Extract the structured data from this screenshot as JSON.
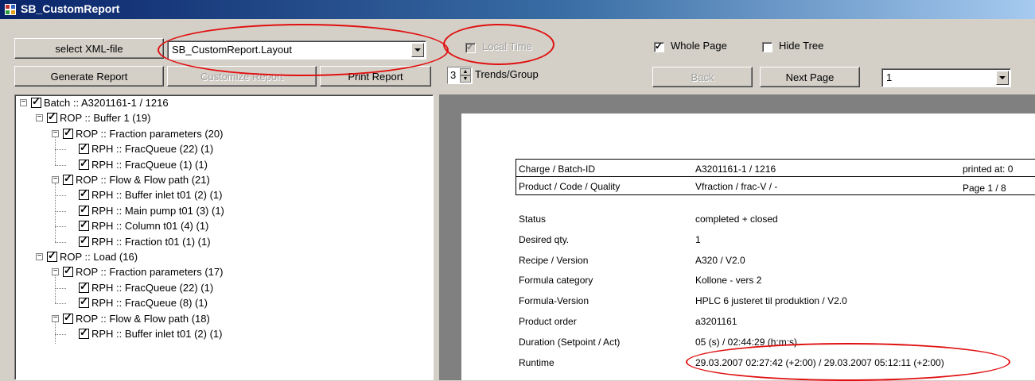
{
  "window": {
    "title": "SB_CustomReport"
  },
  "toolbar": {
    "select_xml_label": "select XML-file",
    "layout_value": "SB_CustomReport.Layout",
    "generate_label": "Generate Report",
    "customize_label": "Customize Report",
    "print_label": "Print Report",
    "local_time_label": "Local Time",
    "local_time_checked": true,
    "trends_value": "3",
    "trends_label": "Trends/Group",
    "whole_page_label": "Whole Page",
    "whole_page_checked": true,
    "hide_tree_label": "Hide Tree",
    "hide_tree_checked": false,
    "back_label": "Back",
    "next_page_label": "Next Page",
    "page_value": "1"
  },
  "tree": [
    {
      "text": "Batch :: A3201161-1 / 1216",
      "level": 0,
      "expander": true
    },
    {
      "text": "ROP :: Buffer 1 (19)",
      "level": 1,
      "expander": true
    },
    {
      "text": "ROP :: Fraction parameters (20)",
      "level": 2,
      "expander": true
    },
    {
      "text": "RPH :: FracQueue (22) (1)",
      "level": 3,
      "expander": false
    },
    {
      "text": "RPH :: FracQueue (1) (1)",
      "level": 3,
      "expander": false
    },
    {
      "text": "ROP :: Flow & Flow path (21)",
      "level": 2,
      "expander": true
    },
    {
      "text": "RPH :: Buffer inlet t01 (2) (1)",
      "level": 3,
      "expander": false
    },
    {
      "text": "RPH :: Main pump t01 (3) (1)",
      "level": 3,
      "expander": false
    },
    {
      "text": "RPH :: Column t01 (4) (1)",
      "level": 3,
      "expander": false
    },
    {
      "text": "RPH :: Fraction t01 (1) (1)",
      "level": 3,
      "expander": false
    },
    {
      "text": "ROP :: Load (16)",
      "level": 1,
      "expander": true
    },
    {
      "text": "ROP :: Fraction parameters (17)",
      "level": 2,
      "expander": true
    },
    {
      "text": "RPH :: FracQueue (22) (1)",
      "level": 3,
      "expander": false
    },
    {
      "text": "RPH :: FracQueue (8) (1)",
      "level": 3,
      "expander": false
    },
    {
      "text": "ROP :: Flow & Flow path (18)",
      "level": 2,
      "expander": true
    },
    {
      "text": "RPH :: Buffer inlet t01 (2) (1)",
      "level": 3,
      "expander": false
    }
  ],
  "report": {
    "header": [
      {
        "label": "Charge / Batch-ID",
        "value": "A3201161-1 / 1216",
        "right": "printed at: 0"
      },
      {
        "label": "Product / Code / Quality",
        "value": "Vfraction / frac-V / -",
        "right": "Page 1 / 8"
      }
    ],
    "rows": [
      {
        "label": "Status",
        "value": "completed + closed"
      },
      {
        "label": "Desired qty.",
        "value": "1"
      },
      {
        "label": "Recipe / Version",
        "value": "A320 / V2.0"
      },
      {
        "label": "Formula category",
        "value": "Kollone - vers 2"
      },
      {
        "label": "Formula-Version",
        "value": "HPLC 6 justeret til produktion / V2.0"
      },
      {
        "label": "Product order",
        "value": "a3201161"
      },
      {
        "label": "Duration (Setpoint / Act)",
        "value": "05 (s) / 02:44:29 (h:m:s)"
      },
      {
        "label": "Runtime",
        "value": "29.03.2007 02:27:42 (+2:00) / 29.03.2007 05:12:11 (+2:00)"
      }
    ]
  },
  "colors": {
    "annotation": "#e01010",
    "titlebar": "#0a246a"
  }
}
